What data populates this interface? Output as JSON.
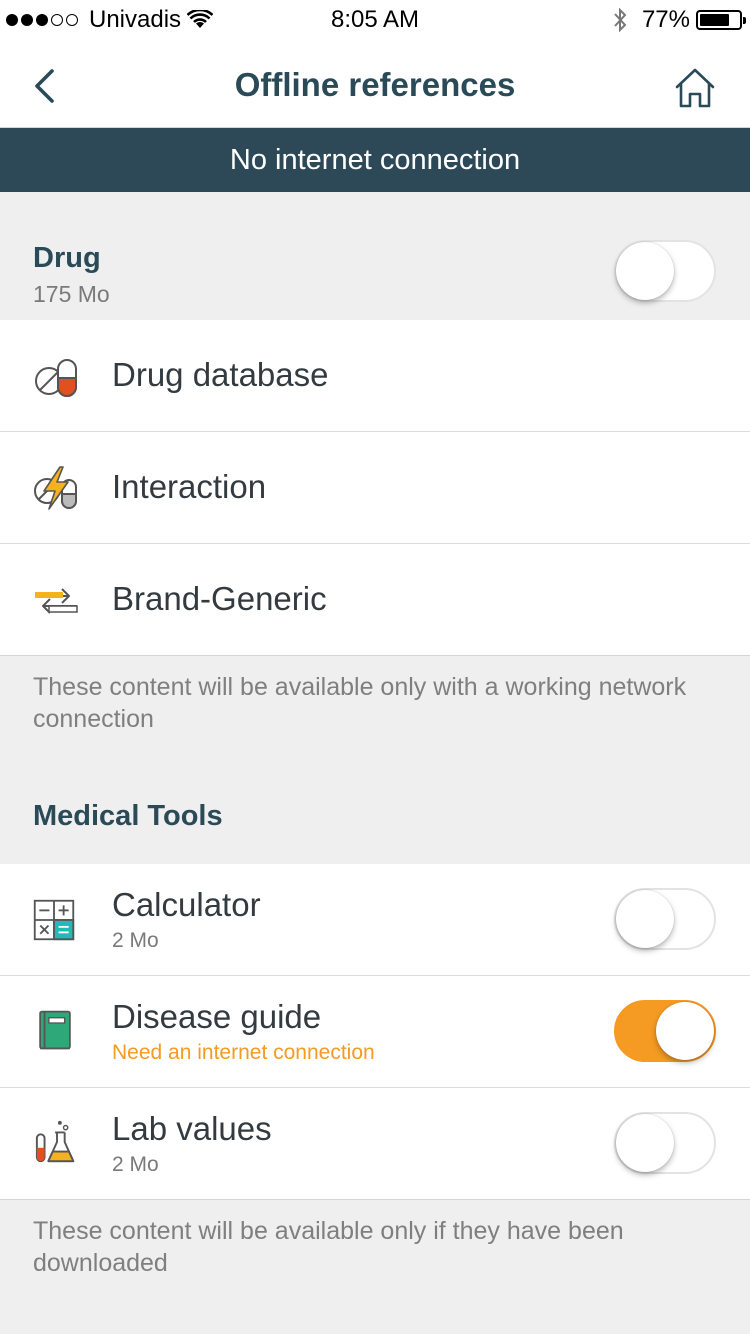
{
  "status_bar": {
    "carrier": "Univadis",
    "time": "8:05 AM",
    "battery_percent": "77%",
    "battery_level": 0.77,
    "signal_bars": 3,
    "signal_total": 5
  },
  "nav": {
    "title": "Offline references",
    "back_icon": "chevron-left-icon",
    "home_icon": "home-icon"
  },
  "banner": {
    "text": "No internet connection"
  },
  "drug_section": {
    "title": "Drug",
    "size": "175 Mo",
    "toggle_on": false,
    "items": [
      {
        "label": "Drug database",
        "icon": "pill-capsule-icon"
      },
      {
        "label": "Interaction",
        "icon": "interaction-bolt-icon"
      },
      {
        "label": "Brand-Generic",
        "icon": "swap-arrows-icon"
      }
    ],
    "note": "These content will be available only with a working network connection"
  },
  "tools_section": {
    "title": "Medical Tools",
    "items": [
      {
        "label": "Calculator",
        "sub": "2 Mo",
        "icon": "calculator-icon",
        "toggle_on": false
      },
      {
        "label": "Disease guide",
        "sub": "Need an internet connection",
        "icon": "book-icon",
        "toggle_on": true
      },
      {
        "label": "Lab values",
        "sub": "2 Mo",
        "icon": "lab-flask-icon",
        "toggle_on": false
      }
    ],
    "note": "These content will be available only if they have been downloaded"
  },
  "colors": {
    "accent": "#f59a23",
    "banner_bg": "#2d4957",
    "title_color": "#2b4a58",
    "background": "#efefef"
  }
}
